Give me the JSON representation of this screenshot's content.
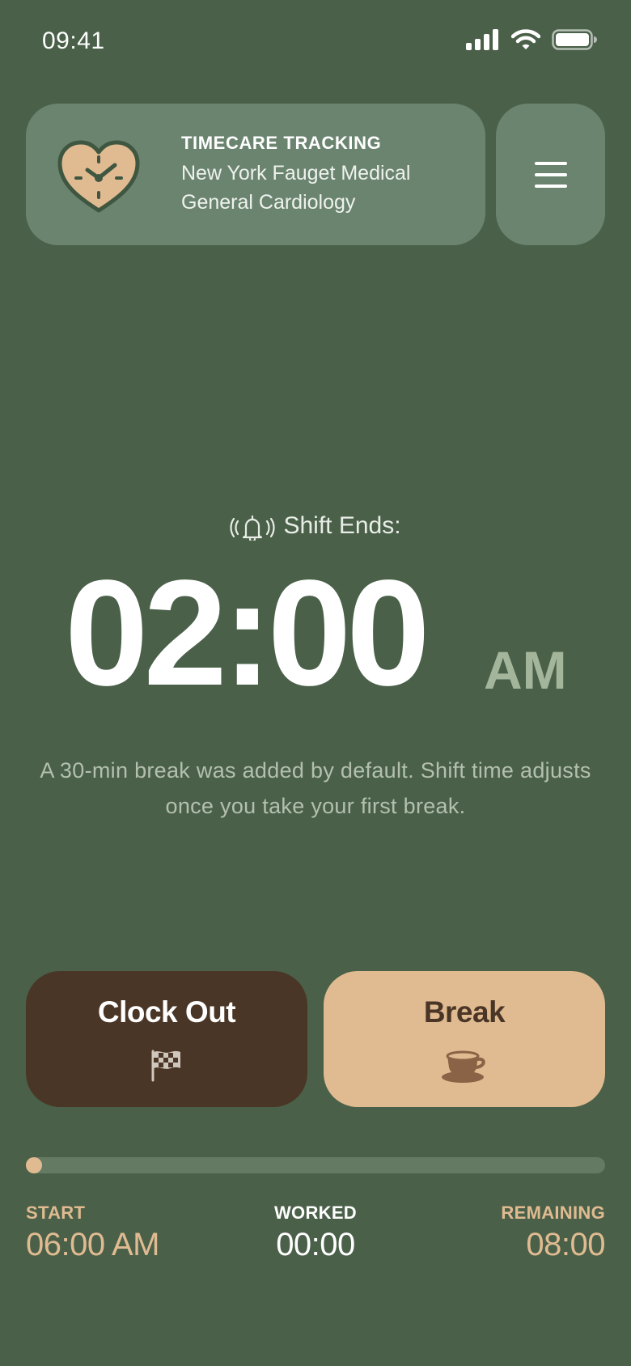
{
  "status_bar": {
    "time": "09:41"
  },
  "header": {
    "title": "TIMECARE TRACKING",
    "facility": "New York Fauget Medical",
    "department": "General Cardiology"
  },
  "shift": {
    "label": "Shift Ends:",
    "time": "02:00",
    "meridiem": "AM",
    "note": "A 30-min break was added by default. Shift time adjusts once you take your first break."
  },
  "actions": {
    "clock_out": "Clock Out",
    "break": "Break"
  },
  "progress": {
    "fraction": 0.0
  },
  "stats": {
    "start_label": "START",
    "start_value": "06:00 AM",
    "worked_label": "WORKED",
    "worked_value": "00:00",
    "remaining_label": "REMAINING",
    "remaining_value": "08:00"
  },
  "colors": {
    "background": "#4a6049",
    "card": "#6b8470",
    "accent": "#e0bb91",
    "dark_brown": "#4a3626"
  },
  "icons": [
    "signal-icon",
    "wifi-icon",
    "battery-icon",
    "heart-clock-icon",
    "hamburger-menu-icon",
    "ringing-bell-icon",
    "checkered-flag-icon",
    "coffee-cup-icon"
  ]
}
